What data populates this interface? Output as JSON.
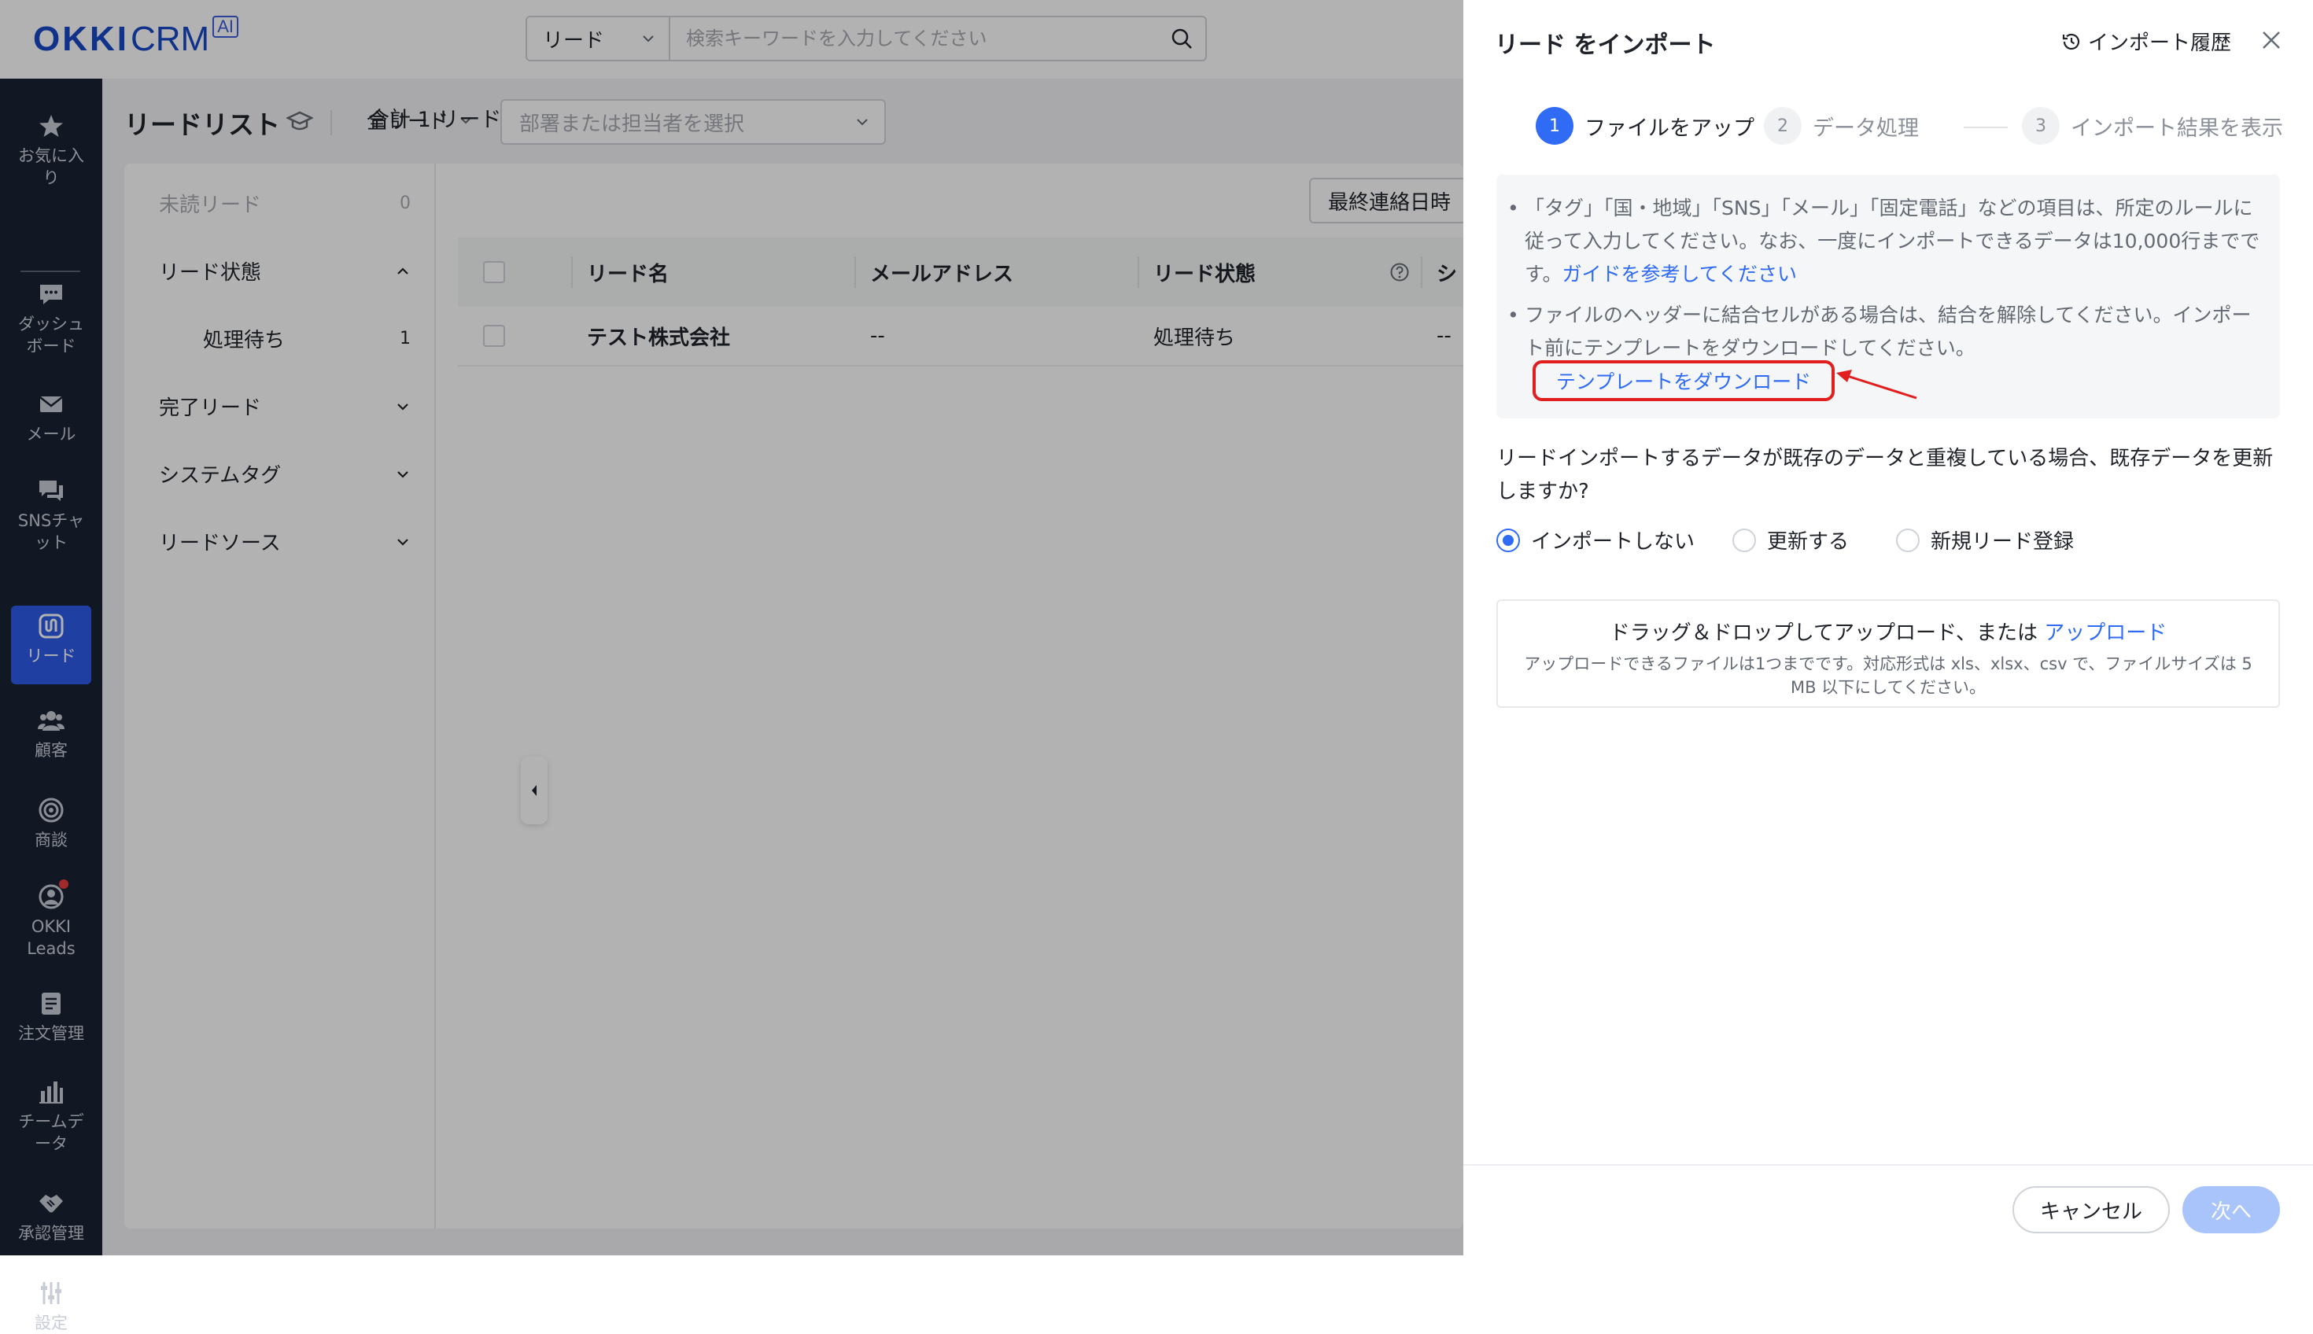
{
  "brand": {
    "name_main": "OKKI",
    "name_sub": "CRM",
    "badge": "AI",
    "color": "#1848c8"
  },
  "search": {
    "type_label": "リード",
    "placeholder": "検索キーワードを入力してください",
    "icon": "search-icon"
  },
  "sidebar": {
    "items": [
      {
        "label": "お気に入り",
        "icon": "star-icon"
      },
      {
        "label": "ダッシュボード",
        "icon": "chat-bubble-icon"
      },
      {
        "label": "メール",
        "icon": "mail-icon"
      },
      {
        "label": "SNSチャット",
        "icon": "sns-chat-icon"
      },
      {
        "label": "リード",
        "icon": "lead-icon",
        "active": true
      },
      {
        "label": "顧客",
        "icon": "customers-icon"
      },
      {
        "label": "商談",
        "icon": "target-icon"
      },
      {
        "label": "OKKI Leads",
        "icon": "okki-leads-icon"
      },
      {
        "label": "注文管理",
        "icon": "order-doc-icon"
      },
      {
        "label": "チームデータ",
        "icon": "bar-chart-icon"
      },
      {
        "label": "承認管理",
        "icon": "handshake-icon"
      },
      {
        "label": "設定",
        "icon": "settings-sliders-icon"
      }
    ]
  },
  "page": {
    "title": "リードリスト",
    "view_select": "全リード",
    "dept_placeholder": "部署または担当者を選択"
  },
  "filters": {
    "unread": {
      "label": "未読リード",
      "count": "0"
    },
    "status_group": "リード状態",
    "pending": {
      "label": "処理待ち",
      "count": "1"
    },
    "completed": "完了リード",
    "system_tags": "システムタグ",
    "source": "リードソース"
  },
  "list": {
    "total": "合計 1 リード",
    "sort_label": "最終連絡日時",
    "columns": [
      "リード名",
      "メールアドレス",
      "リード状態",
      "シ"
    ],
    "rows": [
      {
        "name": "テスト株式会社",
        "email": "--",
        "status": "処理待ち",
        "extra": "--"
      }
    ]
  },
  "drawer": {
    "title": "リード をインポート",
    "history_label": "インポート履歴",
    "steps": [
      {
        "num": "1",
        "label": "ファイルをアップ"
      },
      {
        "num": "2",
        "label": "データ処理"
      },
      {
        "num": "3",
        "label": "インポート結果を表示"
      }
    ],
    "notice": {
      "item1_text": "「タグ」「国・地域」「SNS」「メール」「固定電話」などの項目は、所定のルールに従って入力してください。なお、一度にインポートできるデータは10,000行までです。",
      "item1_link": "ガイドを参考してください",
      "item2_text": "ファイルのヘッダーに結合セルがある場合は、結合を解除してください。インポート前にテンプレートをダウンロードしてください。",
      "template_link": "テンプレートをダウンロード"
    },
    "question": "リードインポートするデータが既存のデータと重複している場合、既存データを更新しますか?",
    "options": [
      "インポートしない",
      "更新する",
      "新規リード登録"
    ],
    "upload": {
      "main_text": "ドラッグ＆ドロップしてアップロード、または",
      "link": "アップロード",
      "sub_text": "アップロードできるファイルは1つまでです。対応形式は xls、xlsx、csv で、ファイルサイズは 5 MB 以下にしてください。"
    },
    "cancel": "キャンセル",
    "next": "次へ"
  },
  "colors": {
    "accent": "#2f6bf5",
    "sidebar_bg": "#1b2234",
    "annotation_red": "#e21f1f"
  }
}
